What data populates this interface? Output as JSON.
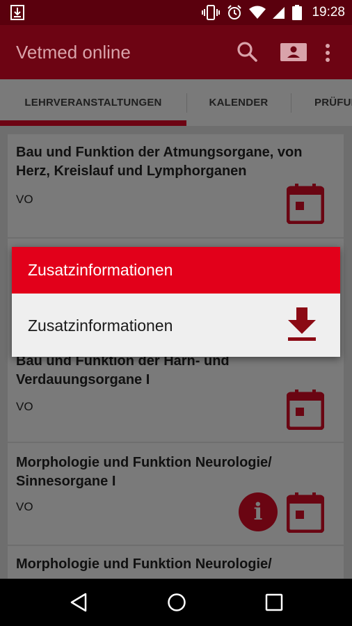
{
  "status_bar": {
    "time": "19:28"
  },
  "app_bar": {
    "title": "Vetmed online"
  },
  "tabs": [
    {
      "label": "LEHRVERANSTALTUNGEN"
    },
    {
      "label": "KALENDER"
    },
    {
      "label": "PRÜFUNGEN"
    }
  ],
  "courses": [
    {
      "title": "Bau und Funktion der Atmungsorgane, von Herz, Kreislauf und Lymphorganen",
      "type": "VO"
    },
    {
      "title": "Bau und Funktion der Harn- und Verdauungsorgane I",
      "type": "VO"
    },
    {
      "title": "Morphologie und Funktion Neurologie/ Sinnesorgane I",
      "type": "VO"
    },
    {
      "title": "Morphologie und Funktion Neurologie/",
      "type": ""
    }
  ],
  "dialog": {
    "title": "Zusatzinformationen",
    "item_label": "Zusatzinformationen"
  },
  "colors": {
    "primary": "#6d0413",
    "accent": "#e2001a",
    "status_bar": "#5a000d",
    "overlay_bg": "#6e6e6e"
  },
  "icons": {
    "status": [
      "download-notification-icon",
      "vibrate-icon",
      "alarm-icon",
      "wifi-icon",
      "signal-icon",
      "battery-icon"
    ],
    "app_bar": [
      "search-icon",
      "account-card-icon",
      "overflow-menu-icon"
    ],
    "course": [
      "calendar-icon",
      "info-icon"
    ],
    "dialog": [
      "download-icon"
    ],
    "nav": [
      "back-icon",
      "home-icon",
      "recents-icon"
    ]
  }
}
